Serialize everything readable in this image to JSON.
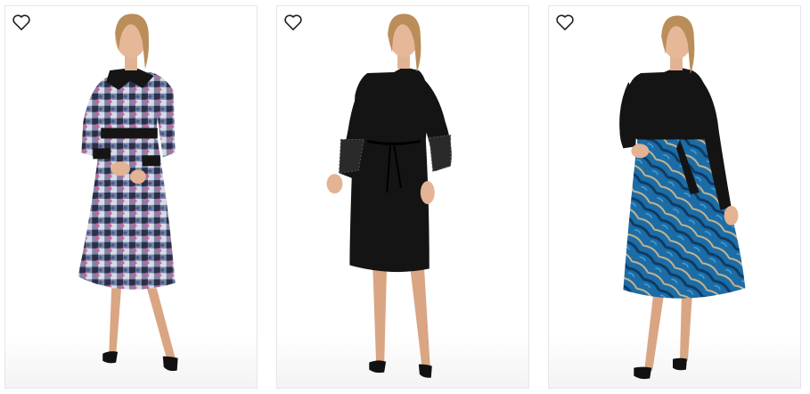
{
  "products": [
    {
      "favorite_icon": "heart-outline-icon",
      "image": "model-patterned-satin-dress",
      "colors": {
        "main": "#6c7390",
        "accent": "#141414"
      }
    },
    {
      "favorite_icon": "heart-outline-icon",
      "image": "model-black-tie-waist-dress",
      "colors": {
        "main": "#141414"
      }
    },
    {
      "favorite_icon": "heart-outline-icon",
      "image": "model-black-top-blue-satin-skirt-dress",
      "colors": {
        "main": "#1f6fa4",
        "accent": "#141414"
      }
    }
  ]
}
